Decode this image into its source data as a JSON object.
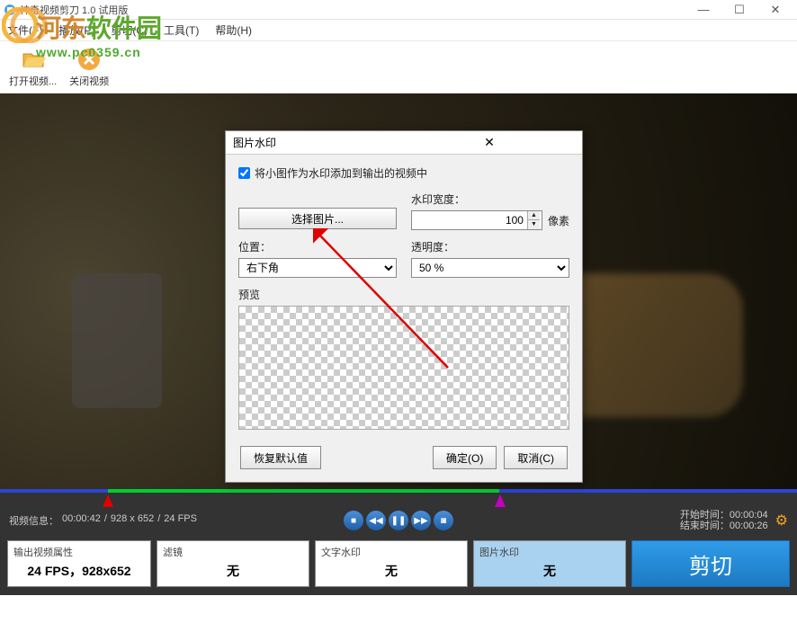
{
  "window": {
    "title": "神奇视频剪刀  1.0    试用版",
    "min": "—",
    "max": "☐",
    "close": "✕"
  },
  "menubar": {
    "file": "文件(F)",
    "play": "播放(P)",
    "cut": "剪切(C)",
    "tools": "工具(T)",
    "help": "帮助(H)"
  },
  "toolbar": {
    "open": "打开视频...",
    "close": "关闭视频"
  },
  "watermark": {
    "brand_main": "河东",
    "brand_sub": "软件园",
    "url": "www.pc0359.cn"
  },
  "dialog": {
    "title": "图片水印",
    "checkbox_label": "将小图作为水印添加到输出的视频中",
    "select_image": "选择图片...",
    "width_label": "水印宽度：",
    "width_value": "100",
    "width_unit": "像素",
    "position_label": "位置：",
    "position_value": "右下角",
    "opacity_label": "透明度：",
    "opacity_value": "50 %",
    "preview_label": "预览",
    "restore": "恢复默认值",
    "ok": "确定(O)",
    "cancel": "取消(C)"
  },
  "status": {
    "info_label": "视频信息：",
    "duration": "00:00:42",
    "resolution": "928 x 652",
    "fps": "24 FPS",
    "start_label": "开始时间：",
    "start_value": "00:00:04",
    "end_label": "结束时间：",
    "end_value": "00:00:26"
  },
  "panels": {
    "output_label": "输出视频属性",
    "output_value": "24 FPS，928x652",
    "filter_label": "滤镜",
    "filter_value": "无",
    "text_label": "文字水印",
    "text_value": "无",
    "image_label": "图片水印",
    "image_value": "无",
    "cut": "剪切"
  }
}
